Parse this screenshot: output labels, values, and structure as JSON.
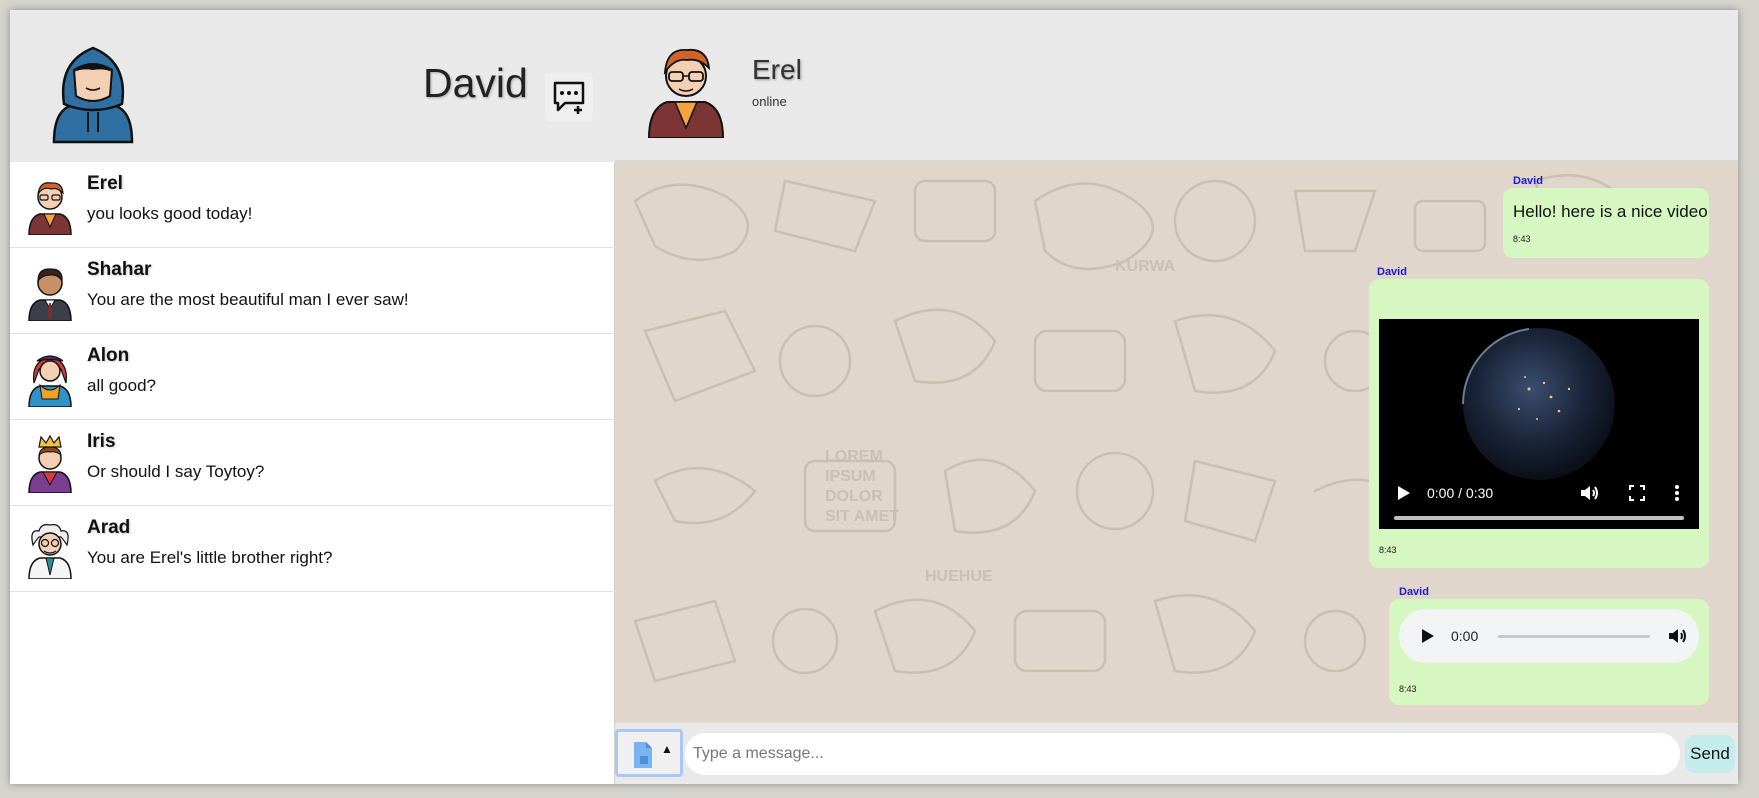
{
  "current_user": {
    "name": "David",
    "avatar_icon": "hooded-person-avatar"
  },
  "new_chat": {
    "icon": "chat-add-icon"
  },
  "contacts": [
    {
      "name": "Erel",
      "last_message": "you looks good today!",
      "avatar_icon": "glasses-man-avatar"
    },
    {
      "name": "Shahar",
      "last_message": "You are the most beautiful man I ever saw!",
      "avatar_icon": "suit-man-avatar"
    },
    {
      "name": "Alon",
      "last_message": "all good?",
      "avatar_icon": "red-hair-woman-avatar"
    },
    {
      "name": "Iris",
      "last_message": "Or should I say Toytoy?",
      "avatar_icon": "king-avatar"
    },
    {
      "name": "Arad",
      "last_message": "You are Erel's little brother right?",
      "avatar_icon": "scientist-avatar"
    }
  ],
  "chat": {
    "peer": {
      "name": "Erel",
      "status": "online",
      "avatar_icon": "glasses-man-avatar"
    },
    "messages": [
      {
        "sender": "David",
        "type": "text",
        "text": "Hello! here is a nice video",
        "time": "8:43"
      },
      {
        "sender": "David",
        "type": "video",
        "player_time": "0:00 / 0:30",
        "time": "8:43"
      },
      {
        "sender": "David",
        "type": "audio",
        "player_time": "0:00",
        "time": "8:43"
      }
    ]
  },
  "composer": {
    "placeholder": "Type a message...",
    "send_label": "Send",
    "attach_icon": "file-attach-icon"
  },
  "colors": {
    "bubble": "#d6f7c2",
    "sender": "#1b1bd6",
    "header": "#e9e9e9",
    "chat_bg": "#e0d6cb",
    "send_button": "#c4ecec"
  }
}
